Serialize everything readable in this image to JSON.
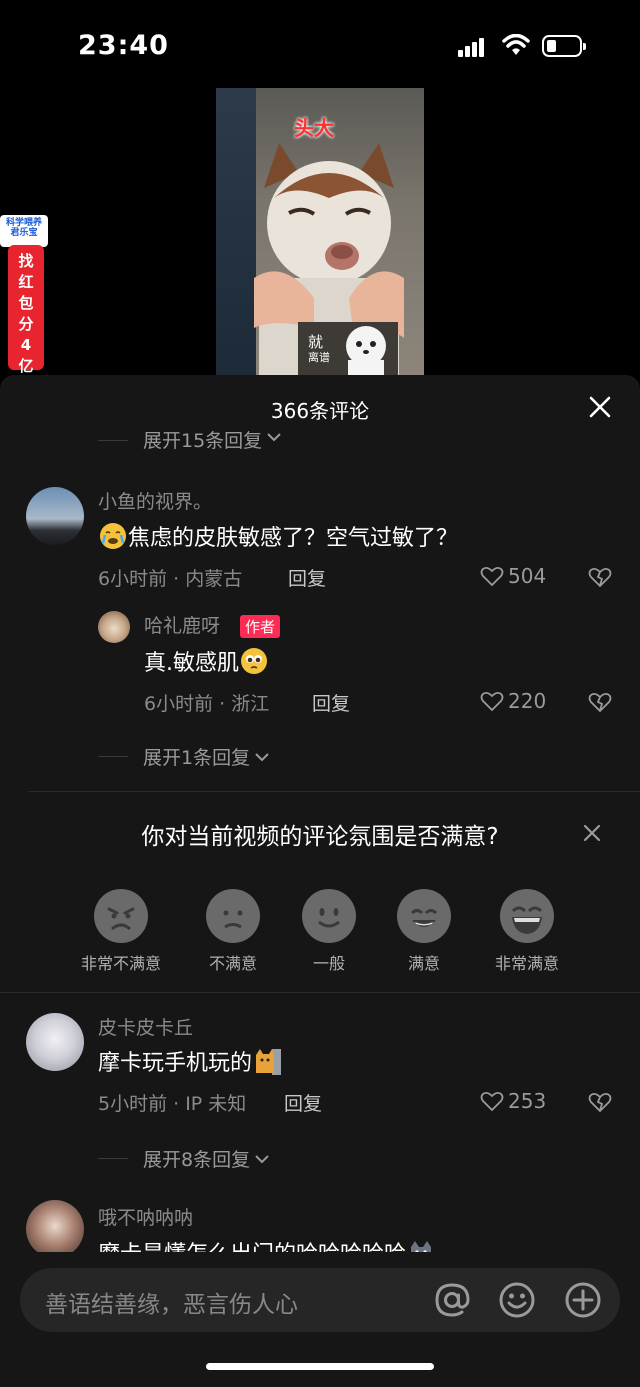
{
  "status_bar": {
    "time": "23:40"
  },
  "video": {
    "caption": "头大",
    "sticker_line1": "就",
    "sticker_line2": "离谱"
  },
  "ad": {
    "head_line1": "科学喂养",
    "head_line2": "君乐宝",
    "text": "找红包分4亿"
  },
  "comments_sheet": {
    "title": "366条评论",
    "top_expand": "展开15条回复",
    "comments": [
      {
        "username": "小鱼的视界。",
        "text": "焦虑的皮肤敏感了？空气过敏了？",
        "meta": "6小时前 · 内蒙古",
        "reply_label": "回复",
        "likes": "504",
        "reply": {
          "username": "哈礼鹿呀",
          "badge": "作者",
          "text": "真.敏感肌",
          "meta": "6小时前 · 浙江",
          "reply_label": "回复",
          "likes": "220"
        },
        "expand": "展开1条回复"
      },
      {
        "username": "皮卡皮卡丘",
        "text": "摩卡玩手机玩的",
        "meta": "5小时前 · IP 未知",
        "reply_label": "回复",
        "likes": "253",
        "expand": "展开8条回复"
      },
      {
        "username": "哦不呐呐呐",
        "text": "摩卡是懂怎么出门的哈哈哈哈哈"
      }
    ],
    "survey": {
      "question": "你对当前视频的评论氛围是否满意?",
      "options": [
        "非常不满意",
        "不满意",
        "一般",
        "满意",
        "非常满意"
      ]
    }
  },
  "input_bar": {
    "placeholder": "善语结善缘，恶言伤人心",
    "icons": [
      "at-icon",
      "emoji-icon",
      "plus-icon"
    ]
  }
}
